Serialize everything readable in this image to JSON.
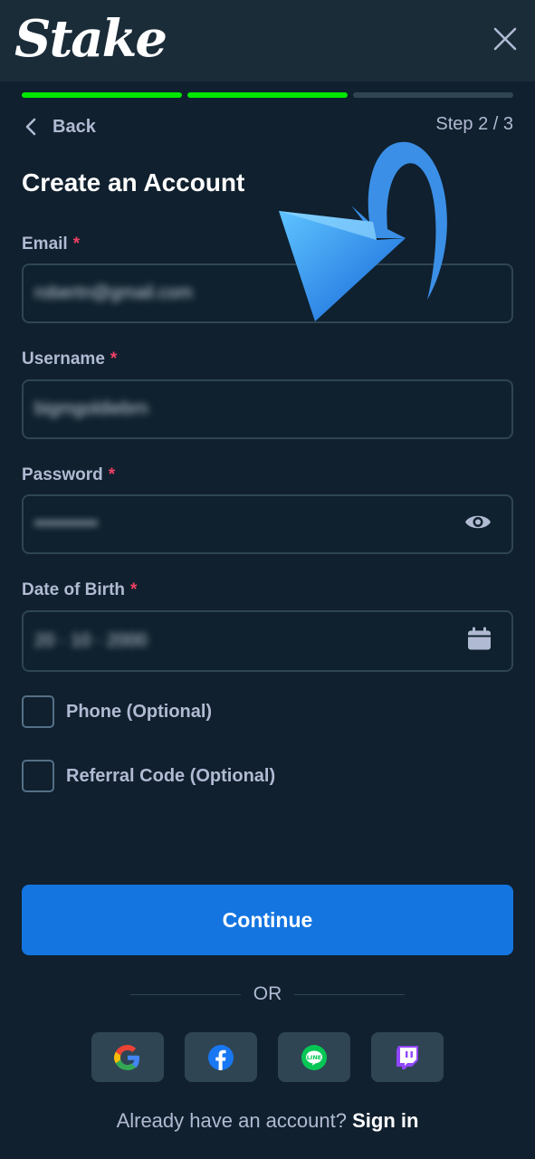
{
  "header": {
    "logo_text": "Stake",
    "close_icon": "close-icon"
  },
  "progress": {
    "total_steps": 3,
    "completed_steps": 2,
    "active_color": "#00e701",
    "inactive_color": "#2f4553"
  },
  "nav": {
    "back_label": "Back",
    "step_label": "Step 2 / 3"
  },
  "form": {
    "title": "Create an Account",
    "required_mark": "*",
    "email": {
      "label": "Email",
      "value": "robertn@gmail.com"
    },
    "username": {
      "label": "Username",
      "value": "bigmgoldiebrn"
    },
    "password": {
      "label": "Password",
      "value": "••••••••••",
      "icon": "eye-icon"
    },
    "dob": {
      "label": "Date of Birth",
      "value": "20 · 10 · 2000",
      "icon": "calendar-icon"
    },
    "phone_checkbox": {
      "label": "Phone (Optional)",
      "checked": false
    },
    "referral_checkbox": {
      "label": "Referral Code (Optional)",
      "checked": false
    }
  },
  "actions": {
    "continue_label": "Continue",
    "continue_color": "#1475e1",
    "or_label": "OR"
  },
  "social": [
    "google-icon",
    "facebook-icon",
    "line-icon",
    "twitch-icon"
  ],
  "footer": {
    "prompt": "Already have an account?",
    "signin_label": "Sign in"
  }
}
